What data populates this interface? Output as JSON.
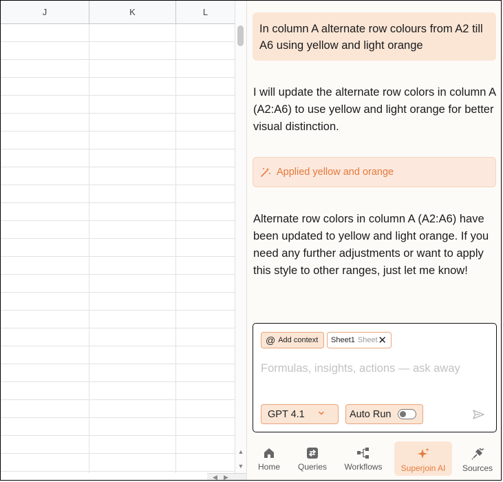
{
  "sheet": {
    "columns": [
      "J",
      "K",
      "L"
    ]
  },
  "chat": {
    "user_message": "In column A alternate row colours from A2 till A6 using yellow and light orange",
    "ai_intro": "I will update the alternate row colors in column A (A2:A6) to use yellow and light orange for better visual distinction.",
    "applied_label": "Applied yellow and orange",
    "ai_result": "Alternate row colors in column A (A2:A6) have been updated to yellow and light orange. If you need any further adjustments or want to apply this style to other ranges, just let me know!"
  },
  "composer": {
    "add_context_label": "Add context",
    "sheet_chip_name": "Sheet1",
    "sheet_chip_type": "Sheet",
    "placeholder": "Formulas, insights, actions — ask away",
    "model_label": "GPT 4.1",
    "auto_run_label": "Auto Run",
    "auto_run_on": false
  },
  "nav": {
    "items": [
      {
        "label": "Home",
        "icon": "home-icon"
      },
      {
        "label": "Queries",
        "icon": "swap-icon"
      },
      {
        "label": "Workflows",
        "icon": "workflow-icon"
      },
      {
        "label": "Superjoin AI",
        "icon": "sparkle-icon"
      },
      {
        "label": "Sources",
        "icon": "plug-icon"
      }
    ],
    "active": "Superjoin AI"
  },
  "colors": {
    "accent": "#e57a3b",
    "bubble": "#fbe6d6",
    "panel_bg": "#fdfbf8"
  }
}
